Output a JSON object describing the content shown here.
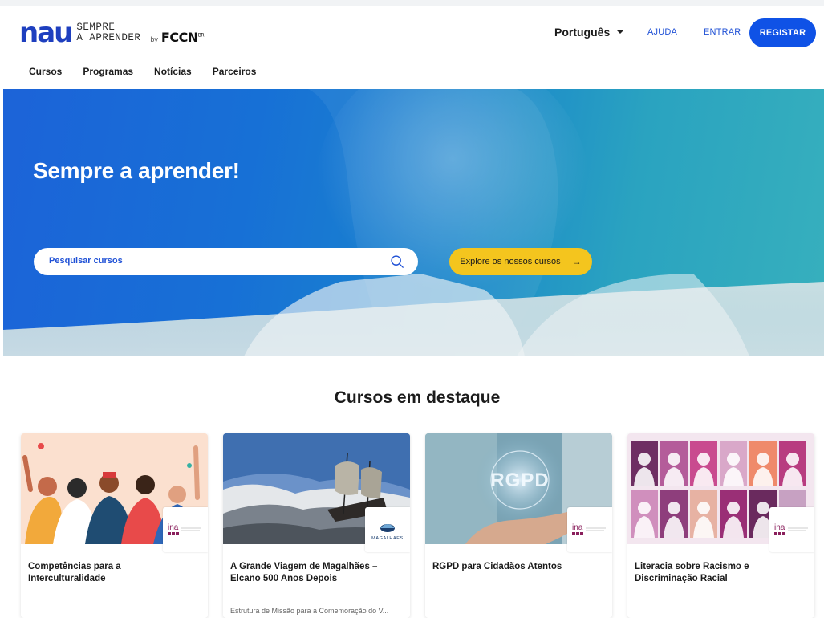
{
  "brand": {
    "logo_text": "nau",
    "tagline_line1": "SEMPRE",
    "tagline_line2": "A APRENDER",
    "by": "by",
    "partner": "FCCN",
    "partner_mark": "BR",
    "primary_color": "#1e3fbf"
  },
  "header": {
    "language": "Português",
    "help": "AJUDA",
    "login": "ENTRAR",
    "register": "REGISTAR"
  },
  "nav": {
    "items": [
      {
        "label": "Cursos"
      },
      {
        "label": "Programas"
      },
      {
        "label": "Notícias"
      },
      {
        "label": "Parceiros"
      }
    ]
  },
  "hero": {
    "title": "Sempre a aprender!",
    "search_placeholder": "Pesquisar cursos",
    "explore": "Explore os nossos cursos",
    "explore_arrow": "→",
    "accent": "#f4c51e"
  },
  "featured": {
    "title": "Cursos em destaque",
    "courses": [
      {
        "title": "Competências para a Interculturalidade",
        "partner_logo": "ina",
        "description": ""
      },
      {
        "title": "A Grande Viagem de Magalhães – Elcano 500 Anos Depois",
        "partner_logo": "MAGALHAES",
        "description": "Estrutura de Missão para a Comemoração do V..."
      },
      {
        "title": "RGPD para Cidadãos Atentos",
        "partner_logo": "ina",
        "description": ""
      },
      {
        "title": "Literacia sobre Racismo e Discriminação Racial",
        "partner_logo": "ina",
        "description": ""
      }
    ]
  }
}
